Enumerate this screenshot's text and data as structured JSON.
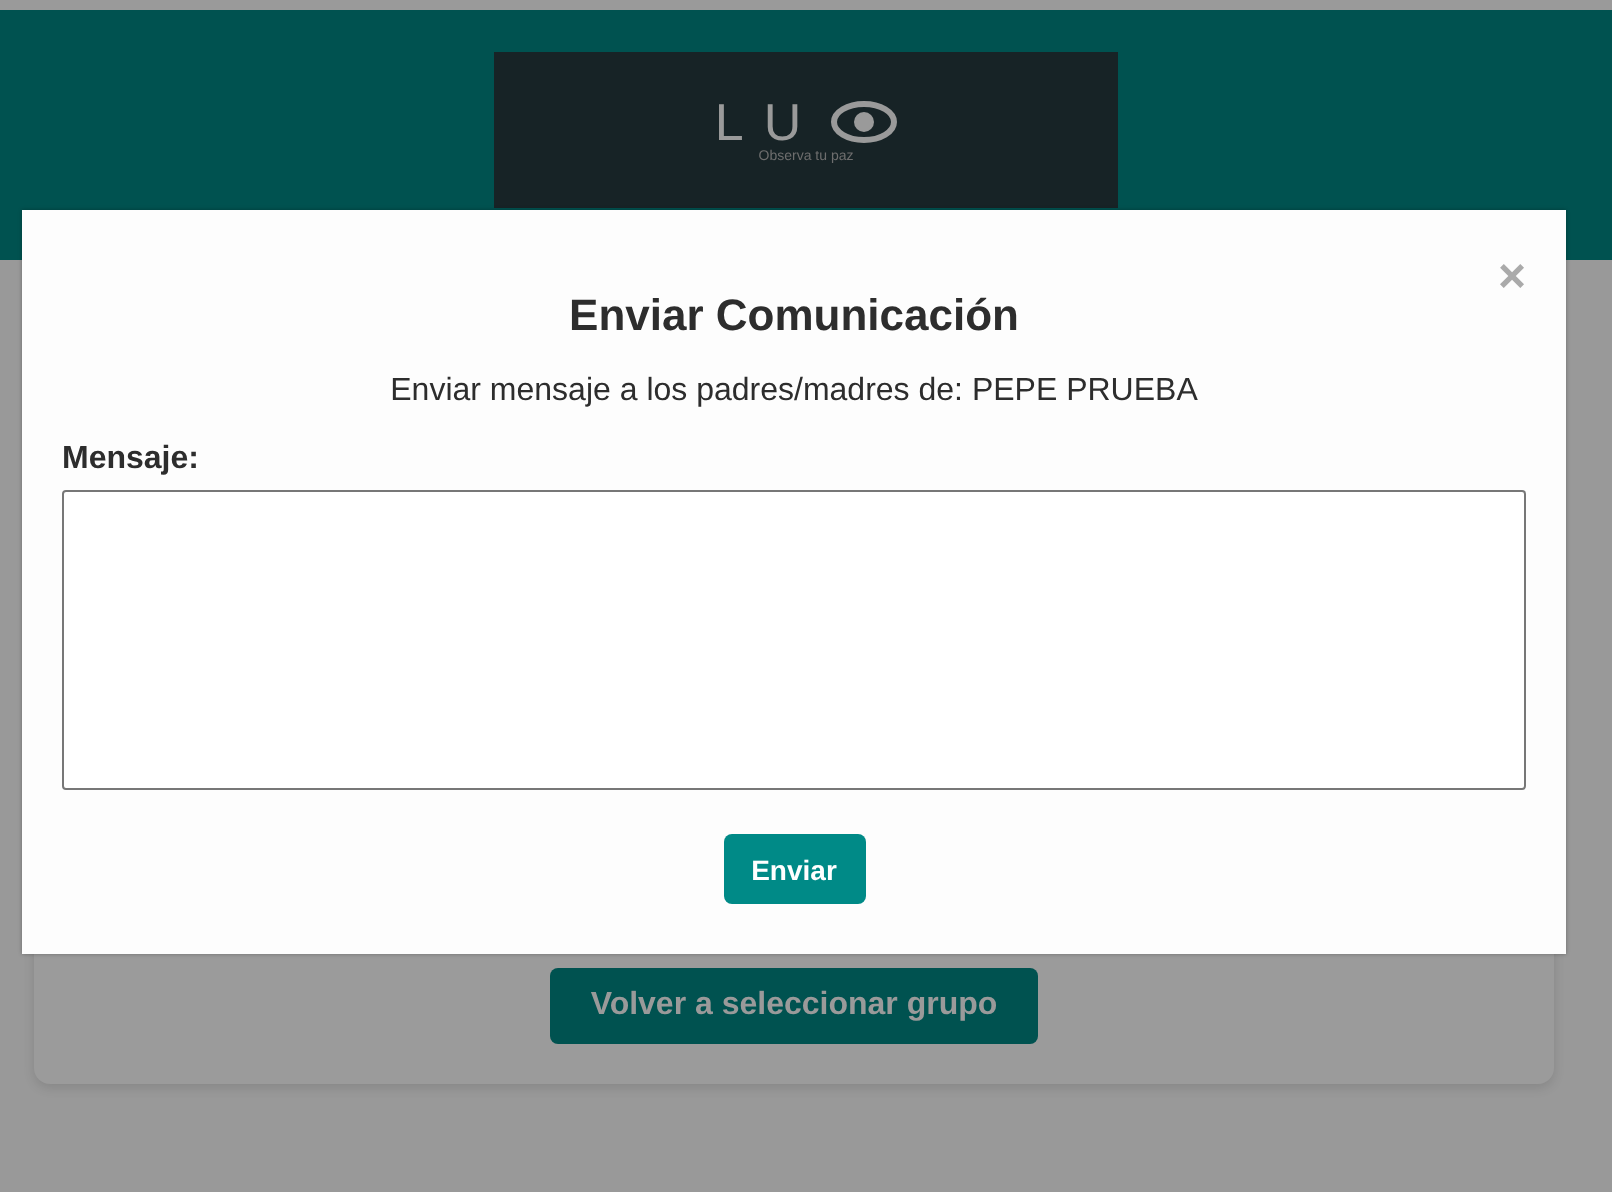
{
  "header": {
    "logo": {
      "wordmark": "LU",
      "tagline": "Observa tu paz"
    }
  },
  "card": {
    "back_button": "Volver a seleccionar grupo"
  },
  "modal": {
    "title": "Enviar Comunicación",
    "close": "×",
    "subtitle": "Enviar mensaje a los padres/madres de: PEPE PRUEBA",
    "message_label": "Mensaje:",
    "send_button": "Enviar"
  }
}
